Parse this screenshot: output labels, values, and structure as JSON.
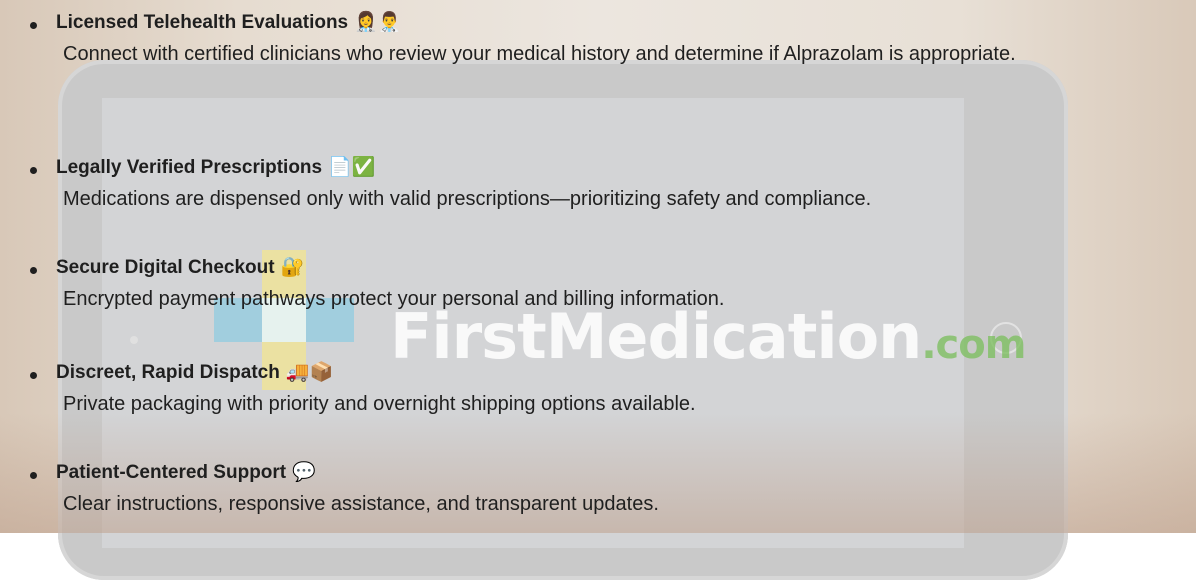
{
  "watermark": {
    "brand": "FirstMedication",
    "tld": ".com"
  },
  "items": [
    {
      "title": "Licensed Telehealth Evaluations",
      "emoji": "👩‍⚕️👨‍⚕️",
      "description": "Connect with certified clinicians who review your medical history and determine if Alprazolam is appropriate."
    },
    {
      "title": "Legally Verified Prescriptions",
      "emoji": "📄✅",
      "description": "Medications are dispensed only with valid prescriptions—prioritizing safety and compliance."
    },
    {
      "title": "Secure Digital Checkout",
      "emoji": "🔐",
      "description": "Encrypted payment pathways protect your personal and billing information."
    },
    {
      "title": "Discreet, Rapid Dispatch",
      "emoji": "🚚📦",
      "description": "Private packaging with priority and overnight shipping options available."
    },
    {
      "title": "Patient-Centered Support",
      "emoji": "💬",
      "description": "Clear instructions, responsive assistance, and transparent updates."
    }
  ]
}
